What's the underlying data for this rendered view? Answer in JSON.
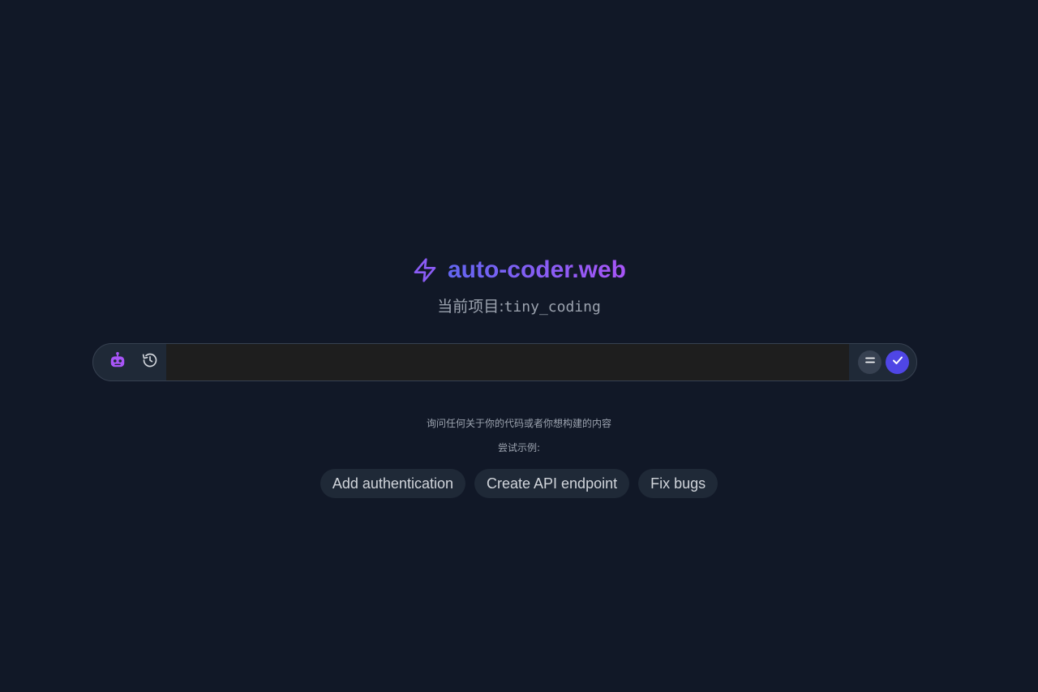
{
  "app": {
    "title": "auto-coder.web",
    "project_label": "当前项目:",
    "project_name": "tiny_coding",
    "accent_start": "#6366f1",
    "accent_end": "#a855f7"
  },
  "input_bar": {
    "left_icons": [
      "robot-icon",
      "history-icon"
    ],
    "value": "",
    "placeholder": "",
    "right_icons": [
      "menu-icon",
      "check-icon"
    ]
  },
  "hint": "询问任何关于你的代码或者你想构建的内容",
  "try_label": "尝试示例:",
  "examples": [
    {
      "label": "Add authentication"
    },
    {
      "label": "Create API endpoint"
    },
    {
      "label": "Fix bugs"
    }
  ]
}
